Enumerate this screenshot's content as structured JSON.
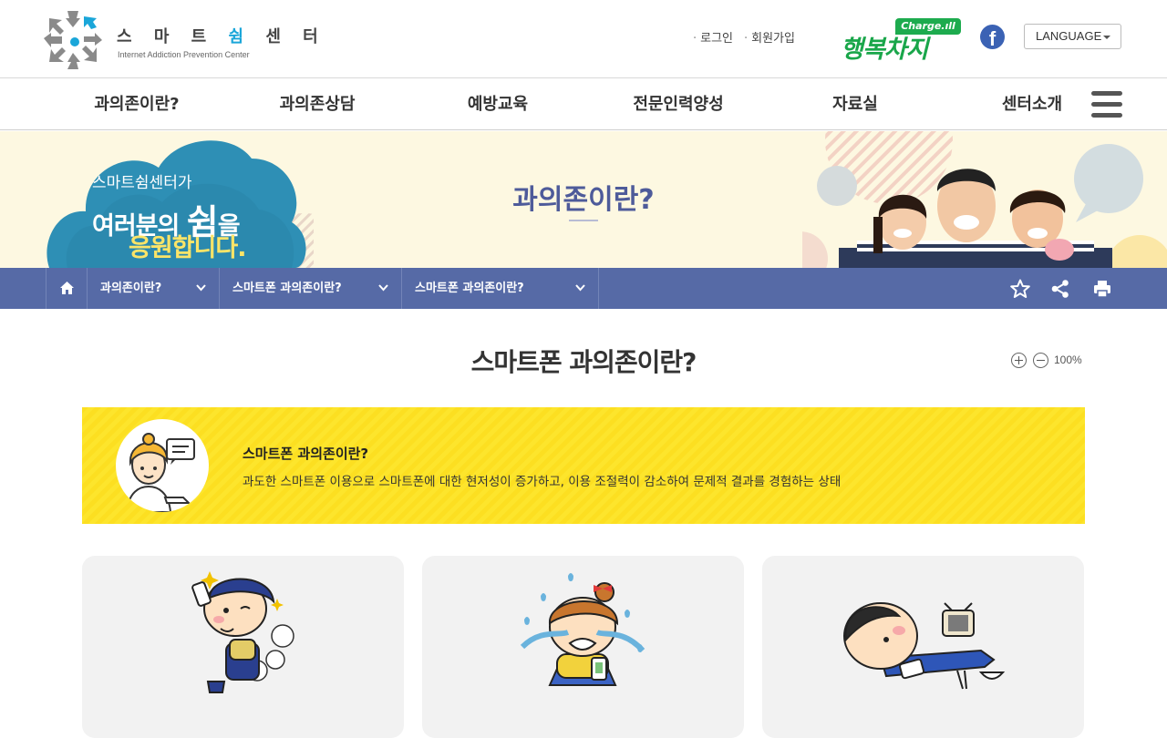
{
  "header": {
    "logo": {
      "title_pre": "스 마 트 ",
      "title_hl": "쉼",
      "title_post": " 센 터",
      "subtitle": "Internet Addiction Prevention Center"
    },
    "util_links": {
      "login": "로그인",
      "join": "회원가입"
    },
    "brand": {
      "charge": "Charge.ıll",
      "text": "행복차지"
    },
    "facebook_glyph": "f",
    "language": {
      "label": "LANGUAGE"
    }
  },
  "gnb": {
    "items": [
      {
        "label": "과의존이란?"
      },
      {
        "label": "과의존상담"
      },
      {
        "label": "예방교육"
      },
      {
        "label": "전문인력양성"
      },
      {
        "label": "자료실"
      },
      {
        "label": "센터소개"
      }
    ],
    "menu_icon": "hamburger-icon"
  },
  "visual": {
    "cloud_line1": "스마트쉼센터가",
    "cloud_line2_pre": "여러분의 ",
    "cloud_line2_big": "쉼",
    "cloud_line2_post": "을",
    "cloud_line3": "응원합니다.",
    "title": "과의존이란?"
  },
  "subnav": {
    "home_icon": "home-icon",
    "crumbs": [
      {
        "label": "과의존이란?"
      },
      {
        "label": "스마트폰 과의존이란?"
      },
      {
        "label": "스마트폰 과의존이란?"
      }
    ],
    "tools": [
      "star-icon",
      "share-icon",
      "print-icon"
    ]
  },
  "content": {
    "page_title": "스마트폰 과의존이란?",
    "zoom": {
      "value": "100%"
    },
    "definition": {
      "title": "스마트폰 과의존이란?",
      "text": "과도한 스마트폰 이용으로 스마트폰에 대한 현저성이 증가하고, 이용 조절력이 감소하여 문제적 결과를 경험하는 상태"
    },
    "cards": [
      {
        "illustration": "salience-character"
      },
      {
        "illustration": "self-control-failure-character"
      },
      {
        "illustration": "serious-consequences-character"
      }
    ]
  },
  "colors": {
    "nav_blue": "#566aa6",
    "title_purple": "#4e5b9a",
    "banner_yellow": "#fde52c",
    "brand_green": "#19a64a",
    "facebook_blue": "#3b62b4"
  }
}
